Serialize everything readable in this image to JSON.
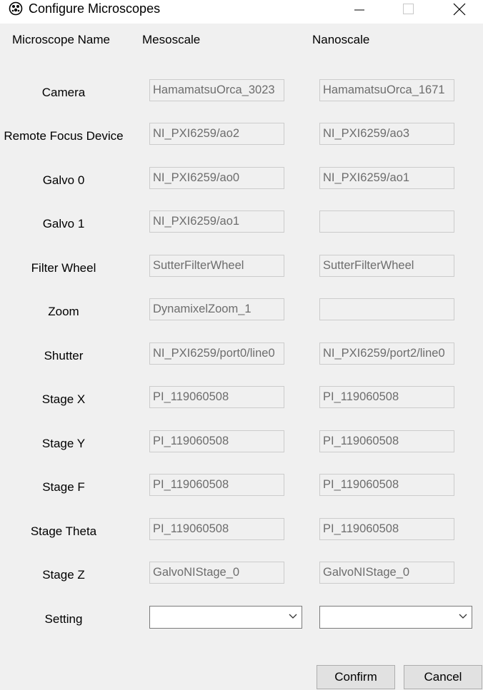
{
  "window": {
    "title": "Configure Microscopes"
  },
  "headers": {
    "name": "Microscope Name",
    "col1": "Mesoscale",
    "col2": "Nanoscale"
  },
  "rows": [
    {
      "label": "Camera",
      "mesoscale": "HamamatsuOrca_3023",
      "nanoscale": "HamamatsuOrca_1671"
    },
    {
      "label": "Remote Focus Device",
      "mesoscale": "NI_PXI6259/ao2",
      "nanoscale": "NI_PXI6259/ao3"
    },
    {
      "label": "Galvo 0",
      "mesoscale": "NI_PXI6259/ao0",
      "nanoscale": "NI_PXI6259/ao1"
    },
    {
      "label": "Galvo 1",
      "mesoscale": "NI_PXI6259/ao1",
      "nanoscale": ""
    },
    {
      "label": "Filter Wheel",
      "mesoscale": "SutterFilterWheel",
      "nanoscale": "SutterFilterWheel"
    },
    {
      "label": "Zoom",
      "mesoscale": "DynamixelZoom_1",
      "nanoscale": ""
    },
    {
      "label": "Shutter",
      "mesoscale": "NI_PXI6259/port0/line0",
      "nanoscale": "NI_PXI6259/port2/line0"
    },
    {
      "label": "Stage X",
      "mesoscale": "PI_119060508",
      "nanoscale": "PI_119060508"
    },
    {
      "label": "Stage Y",
      "mesoscale": "PI_119060508",
      "nanoscale": "PI_119060508"
    },
    {
      "label": "Stage F",
      "mesoscale": "PI_119060508",
      "nanoscale": "PI_119060508"
    },
    {
      "label": "Stage Theta",
      "mesoscale": "PI_119060508",
      "nanoscale": "PI_119060508"
    },
    {
      "label": "Stage Z",
      "mesoscale": "GalvoNIStage_0",
      "nanoscale": "GalvoNIStage_0"
    }
  ],
  "setting": {
    "label": "Setting",
    "mesoscale": "",
    "nanoscale": ""
  },
  "buttons": {
    "confirm": "Confirm",
    "cancel": "Cancel"
  },
  "icons": {
    "app": "microscope-app-icon",
    "minimize": "minimize-icon",
    "maximize": "maximize-icon",
    "close": "close-icon",
    "dropdown": "chevron-down-icon"
  }
}
